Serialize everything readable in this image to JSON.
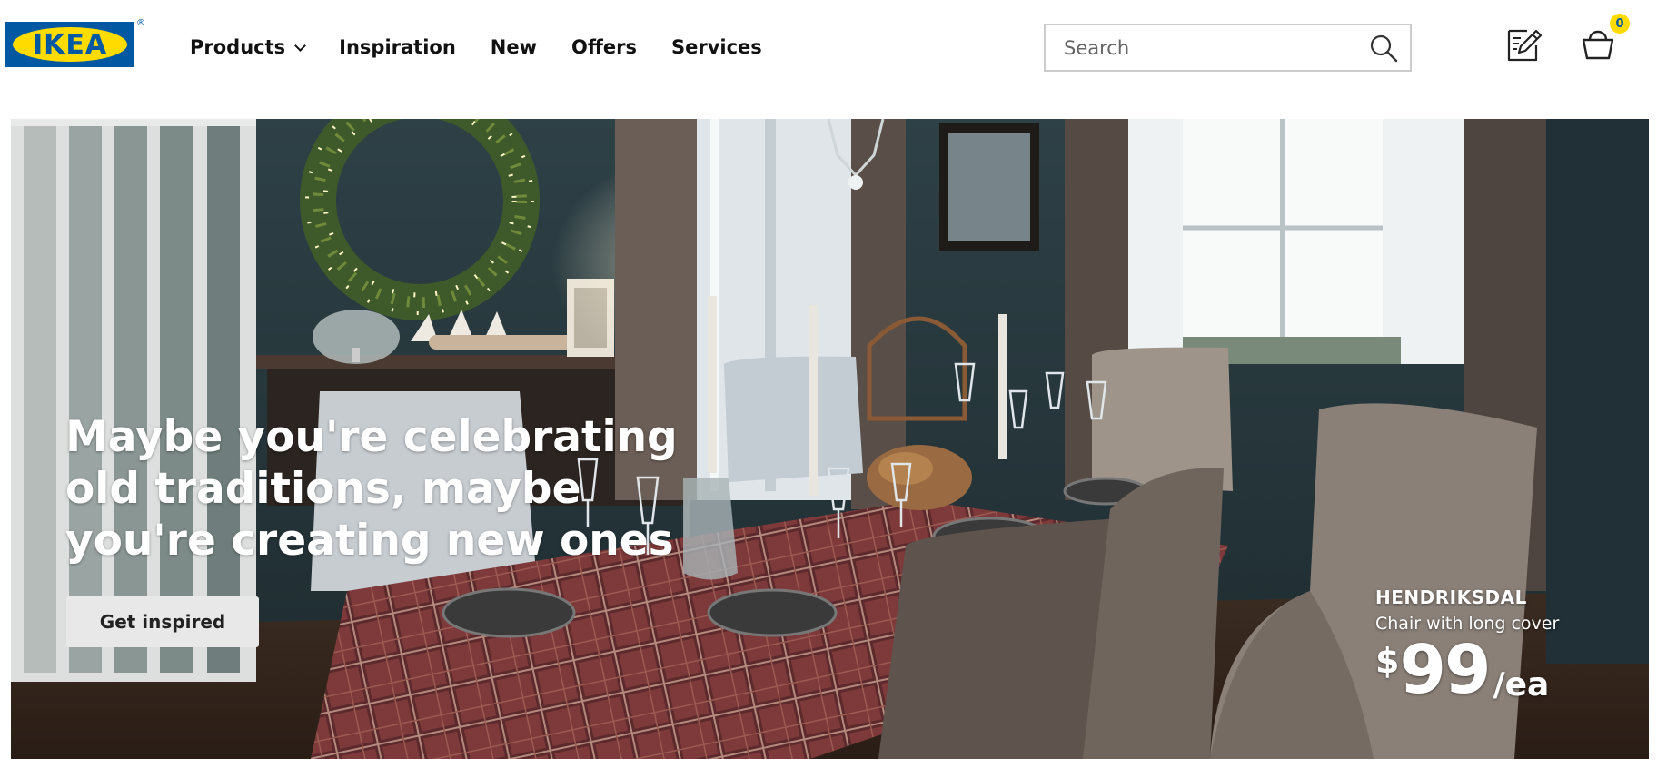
{
  "brand": {
    "logo_text": "IKEA",
    "registered": "®",
    "colors": {
      "blue": "#0058a3",
      "yellow": "#ffdb00"
    }
  },
  "nav": {
    "items": [
      {
        "label": "Products",
        "has_dropdown": true
      },
      {
        "label": "Inspiration"
      },
      {
        "label": "New"
      },
      {
        "label": "Offers"
      },
      {
        "label": "Services"
      }
    ]
  },
  "search": {
    "placeholder": "Search",
    "value": "",
    "icon": "search-icon"
  },
  "header_icons": {
    "list_icon": "shopping-list-icon",
    "cart_icon": "shopping-bag-icon",
    "cart_count": "0"
  },
  "hero": {
    "headline": "Maybe you're celebrating old traditions, maybe you're creating new ones",
    "cta_label": "Get inspired",
    "product": {
      "name": "HENDRIKSDAL",
      "description": "Chair with long cover",
      "currency": "$",
      "price": "99",
      "unit": "/ea"
    }
  }
}
